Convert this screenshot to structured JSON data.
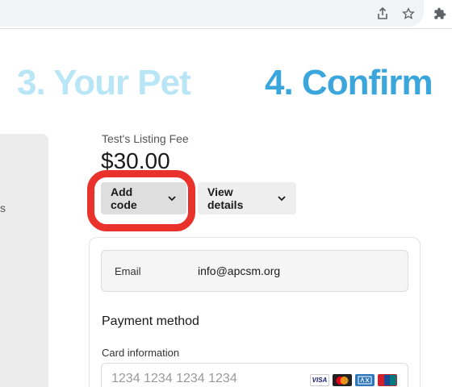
{
  "browser": {
    "icons": [
      "share-icon",
      "star-icon",
      "extensions-icon"
    ]
  },
  "steps": {
    "step3": "3. Your Pet",
    "step4": "4. Confirm"
  },
  "left_panel": {
    "partial_text": "s"
  },
  "checkout": {
    "fee_label": "Test's Listing Fee",
    "fee_amount": "$30.00",
    "add_code_label": "Add code",
    "view_details_label": "View details",
    "email_label": "Email",
    "email_value": "info@apcsm.org",
    "payment_method_title": "Payment method",
    "card_info_label": "Card information",
    "card_placeholder": "1234 1234 1234 1234",
    "card_brands": [
      "VISA",
      "MC",
      "AMEX",
      "UP"
    ]
  },
  "colors": {
    "step_inactive": "#b9e6f7",
    "step_active": "#3aa6dc",
    "highlight": "#e8322b"
  }
}
